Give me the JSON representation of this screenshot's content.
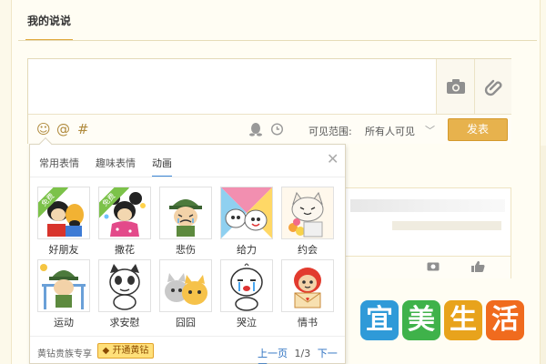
{
  "header": {
    "tab_title": "我的说说"
  },
  "composer": {
    "visibility_label": "可见范围:",
    "visibility_value": "所有人可见",
    "publish_label": "发表",
    "tool_icons": [
      "smile-icon",
      "at-icon",
      "hashtag-icon",
      "qq-icon",
      "timer-icon"
    ],
    "side_icons": [
      "camera-icon",
      "attachment-icon"
    ]
  },
  "emoticon_popup": {
    "tabs": [
      {
        "label": "常用表情",
        "active": false
      },
      {
        "label": "趣味表情",
        "active": false
      },
      {
        "label": "动画",
        "active": true
      }
    ],
    "close_glyph": "✕",
    "items": [
      {
        "label": "好朋友",
        "badge": "免费"
      },
      {
        "label": "撒花",
        "badge": "免费"
      },
      {
        "label": "悲伤"
      },
      {
        "label": "给力"
      },
      {
        "label": "约会"
      },
      {
        "label": "运动"
      },
      {
        "label": "求安慰"
      },
      {
        "label": "囧囧"
      },
      {
        "label": "哭泣"
      },
      {
        "label": "情书"
      }
    ],
    "footer": {
      "vip_text": "黄钻贵族专享",
      "vip_button": "开通黄钻",
      "prev_label": "上一页",
      "page_indicator": "1/3",
      "next_label": "下一页"
    }
  },
  "watermark": {
    "chars": [
      "宜",
      "美",
      "生",
      "活"
    ],
    "colors": [
      "#2f9ad8",
      "#3fb24a",
      "#e8a31c",
      "#f06b1e"
    ]
  },
  "colors": {
    "accent": "#e7b24d",
    "link": "#2a6fc0",
    "active_tab": "#3a85d6"
  }
}
